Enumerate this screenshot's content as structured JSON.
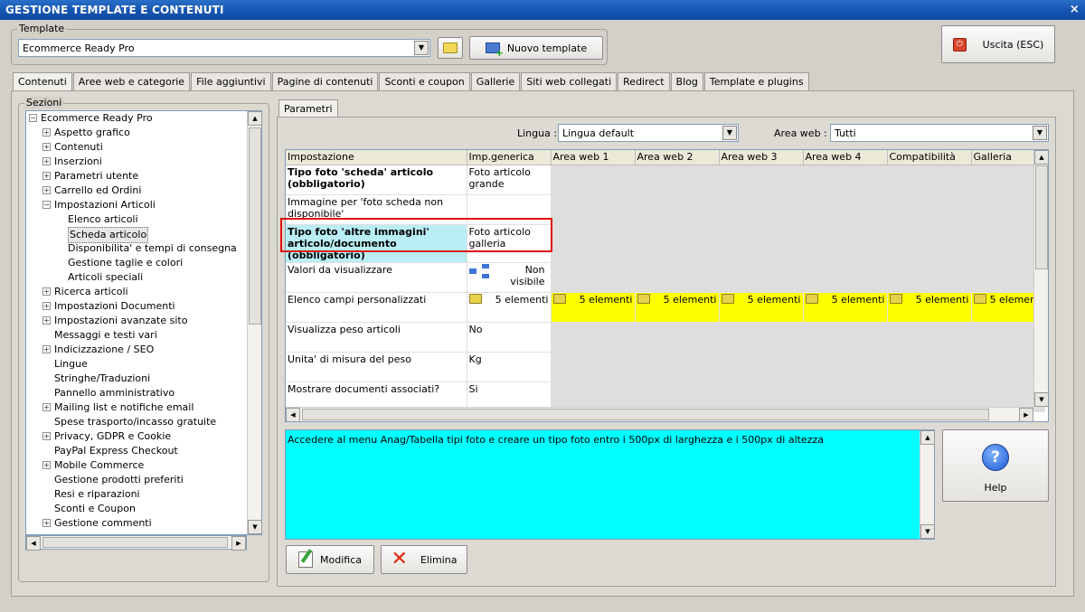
{
  "window": {
    "title": "GESTIONE TEMPLATE E CONTENUTI",
    "close": "×"
  },
  "template_box": {
    "label": "Template",
    "value": "Ecommerce Ready Pro",
    "new_template_label": "Nuovo template"
  },
  "exit_label": "Uscita (ESC)",
  "tabs": [
    "Contenuti",
    "Aree web e categorie",
    "File aggiuntivi",
    "Pagine di contenuti",
    "Sconti e coupon",
    "Gallerie",
    "Siti web collegati",
    "Redirect",
    "Blog",
    "Template e plugins"
  ],
  "sections": {
    "label": "Sezioni",
    "root": "Ecommerce Ready Pro",
    "items": [
      {
        "label": "Aspetto grafico",
        "level": 1,
        "expand": true
      },
      {
        "label": "Contenuti",
        "level": 1,
        "expand": true
      },
      {
        "label": "Inserzioni",
        "level": 1,
        "expand": true
      },
      {
        "label": "Parametri utente",
        "level": 1,
        "expand": true
      },
      {
        "label": "Carrello ed Ordini",
        "level": 1,
        "expand": true
      },
      {
        "label": "Impostazioni Articoli",
        "level": 1,
        "expand": "open"
      },
      {
        "label": "Elenco articoli",
        "level": 2
      },
      {
        "label": "Scheda articolo",
        "level": 2,
        "selected": true
      },
      {
        "label": "Disponibilita' e tempi di consegna",
        "level": 2
      },
      {
        "label": "Gestione taglie e colori",
        "level": 2
      },
      {
        "label": "Articoli speciali",
        "level": 2
      },
      {
        "label": "Ricerca articoli",
        "level": 1,
        "expand": true
      },
      {
        "label": "Impostazioni Documenti",
        "level": 1,
        "expand": true
      },
      {
        "label": "Impostazioni avanzate sito",
        "level": 1,
        "expand": true
      },
      {
        "label": "Messaggi e testi vari",
        "level": 1
      },
      {
        "label": "Indicizzazione / SEO",
        "level": 1,
        "expand": true
      },
      {
        "label": "Lingue",
        "level": 1
      },
      {
        "label": "Stringhe/Traduzioni",
        "level": 1
      },
      {
        "label": "Pannello amministrativo",
        "level": 1
      },
      {
        "label": "Mailing list e notifiche email",
        "level": 1,
        "expand": true
      },
      {
        "label": "Spese trasporto/incasso gratuite",
        "level": 1
      },
      {
        "label": "Privacy, GDPR e Cookie",
        "level": 1,
        "expand": true
      },
      {
        "label": "PayPal Express Checkout",
        "level": 1
      },
      {
        "label": "Mobile Commerce",
        "level": 1,
        "expand": true
      },
      {
        "label": "Gestione prodotti preferiti",
        "level": 1
      },
      {
        "label": "Resi e riparazioni",
        "level": 1
      },
      {
        "label": "Sconti e Coupon",
        "level": 1
      },
      {
        "label": "Gestione commenti",
        "level": 1,
        "expand": true
      }
    ]
  },
  "params": {
    "tab_label": "Parametri",
    "lingua_label": "Lingua :",
    "lingua_value": "Lingua default",
    "area_label": "Area web :",
    "area_value": "Tutti",
    "columns": [
      "Impostazione",
      "Imp.generica",
      "Area web 1",
      "Area web 2",
      "Area web 3",
      "Area web 4",
      "Compatibilità",
      "Galleria"
    ],
    "rows": [
      {
        "name": "Tipo foto 'scheda' articolo (obbligatorio)",
        "bold": true,
        "value": "Foto articolo grande"
      },
      {
        "name": "Immagine per 'foto scheda non disponibile'",
        "bold": false,
        "value": ""
      },
      {
        "name": "Tipo foto 'altre immagini' articolo/documento (obbligatorio)",
        "bold": true,
        "value": "Foto articolo galleria",
        "highlight": true
      },
      {
        "name": "Valori da visualizzare",
        "bold": false,
        "value": "Non visibile",
        "icon": "tree-icon"
      },
      {
        "name": "Elenco campi personalizzati",
        "bold": false,
        "value": "5 elementi",
        "yellow": true,
        "others": "5 elementi"
      },
      {
        "name": "Visualizza peso articoli",
        "bold": false,
        "value": "No"
      },
      {
        "name": "Unita' di misura del peso",
        "bold": false,
        "value": "Kg"
      },
      {
        "name": "Mostrare documenti associati?",
        "bold": false,
        "value": "Si"
      }
    ],
    "help_text": "Accedere al menu Anag/Tabella tipi foto e creare un tipo foto entro i 500px di larghezza e i 500px di altezza",
    "help_label": "Help",
    "modifica_label": "Modifica",
    "elimina_label": "Elimina"
  },
  "colors": {
    "title_bar": "#1656b3",
    "highlight_cell": "#b9eef5",
    "yellow_cell": "#ffff00",
    "info_bg": "#00ffff",
    "red_outline": "#e01010"
  }
}
